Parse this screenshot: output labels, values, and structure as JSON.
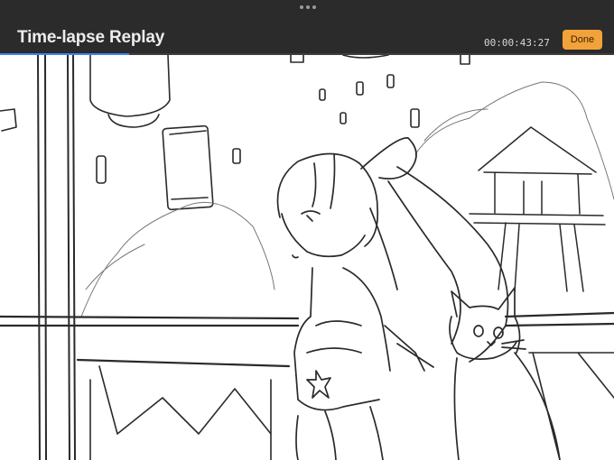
{
  "header": {
    "title": "Time-lapse Replay",
    "elapsed": "00:00:43:27",
    "done_label": "Done",
    "grabber_icon": "more-dots-icon"
  },
  "progress": {
    "fraction": 0.21,
    "color": "#3b82f6"
  },
  "colors": {
    "topbar": "#2b2b2b",
    "accent": "#f2a23a"
  },
  "canvas": {
    "content": "pencil sketch artwork"
  }
}
